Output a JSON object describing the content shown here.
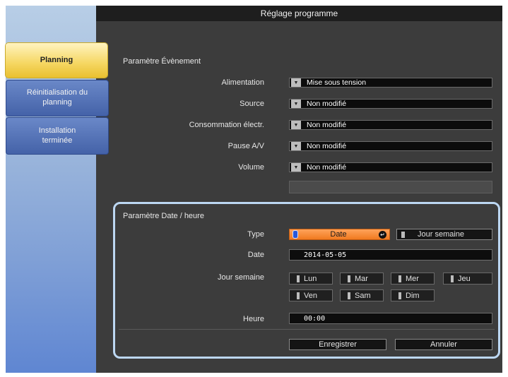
{
  "window": {
    "title": "Réglage programme"
  },
  "nav": [
    {
      "label": "Planning"
    },
    {
      "label": "Réinitialisation du planning"
    },
    {
      "label": "Installation terminée"
    }
  ],
  "event": {
    "title": "Paramètre Évènement",
    "rows": [
      {
        "label": "Alimentation",
        "value": "Mise sous tension"
      },
      {
        "label": "Source",
        "value": "Non modifié"
      },
      {
        "label": "Consommation électr.",
        "value": "Non modifié"
      },
      {
        "label": "Pause A/V",
        "value": "Non modifié"
      },
      {
        "label": "Volume",
        "value": "Non modifié"
      }
    ]
  },
  "datetime": {
    "title": "Paramètre Date / heure",
    "type_label": "Type",
    "type_date": "Date",
    "type_jour": "Jour semaine",
    "date_label": "Date",
    "date_value": "2014-05-05",
    "weekday_label": "Jour semaine",
    "days": [
      "Lun",
      "Mar",
      "Mer",
      "Jeu",
      "Ven",
      "Sam",
      "Dim"
    ],
    "hour_label": "Heure",
    "hour_value": "00:00"
  },
  "actions": {
    "save": "Enregistrer",
    "cancel": "Annuler"
  },
  "colors": {
    "highlight": "#bcd7f2",
    "selected_type": "#f07a20",
    "active_tab": "#f5d660"
  }
}
